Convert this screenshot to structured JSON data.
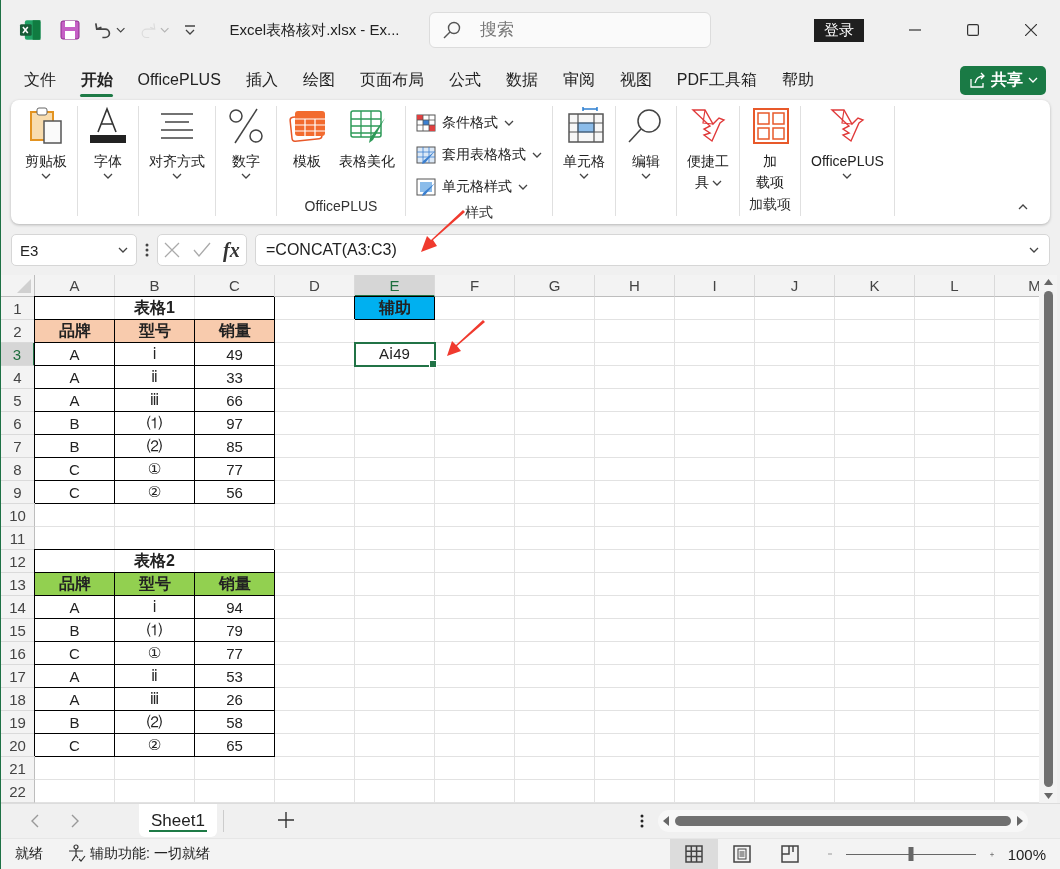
{
  "window": {
    "title": "Excel表格核对.xlsx  -  Ex...",
    "search": {
      "placeholder": "搜索"
    },
    "sign_in": "登录"
  },
  "quick_access": [
    {
      "kind": "save",
      "disabled": false
    },
    {
      "kind": "undo",
      "disabled": false
    },
    {
      "kind": "redo",
      "disabled": true
    },
    {
      "kind": "customize",
      "disabled": false
    }
  ],
  "ribbon_tabs": [
    {
      "label": "文件",
      "selected": false
    },
    {
      "label": "开始",
      "selected": true
    },
    {
      "label": "OfficePLUS",
      "selected": false
    },
    {
      "label": "插入",
      "selected": false
    },
    {
      "label": "绘图",
      "selected": false
    },
    {
      "label": "页面布局",
      "selected": false
    },
    {
      "label": "公式",
      "selected": false
    },
    {
      "label": "数据",
      "selected": false
    },
    {
      "label": "审阅",
      "selected": false
    },
    {
      "label": "视图",
      "selected": false
    },
    {
      "label": "PDF工具箱",
      "selected": false
    },
    {
      "label": "帮助",
      "selected": false
    }
  ],
  "share_button": "共享",
  "ribbon": {
    "groups": [
      {
        "items": [
          {
            "kind": "large",
            "label_lines": [
              "剪贴板"
            ],
            "dropdown": true
          }
        ]
      },
      {
        "items": [
          {
            "kind": "large",
            "label_lines": [
              "字体"
            ],
            "dropdown": true
          }
        ]
      },
      {
        "items": [
          {
            "kind": "large",
            "label_lines": [
              "对齐方式"
            ],
            "dropdown": true
          }
        ]
      },
      {
        "items": [
          {
            "kind": "large",
            "label_lines": [
              "数字"
            ],
            "dropdown": true
          }
        ]
      },
      {
        "label": "OfficePLUS",
        "items": [
          {
            "kind": "large",
            "label_lines": [
              "模板"
            ],
            "dropdown": false
          },
          {
            "kind": "large",
            "label_lines": [
              "表格美化"
            ],
            "dropdown": false
          }
        ]
      },
      {
        "label": "样式",
        "items": [
          {
            "kind": "small",
            "label_lines": [
              "条件格式"
            ],
            "dropdown": true
          },
          {
            "kind": "small",
            "label_lines": [
              "套用表格格式"
            ],
            "dropdown": true
          },
          {
            "kind": "small",
            "label_lines": [
              "单元格样式"
            ],
            "dropdown": true
          }
        ]
      },
      {
        "items": [
          {
            "kind": "large",
            "label_lines": [
              "单元格"
            ],
            "dropdown": true
          }
        ]
      },
      {
        "items": [
          {
            "kind": "large",
            "label_lines": [
              "编辑"
            ],
            "dropdown": true
          }
        ]
      },
      {
        "items": [
          {
            "kind": "large",
            "label_lines": [
              "便捷工",
              "具"
            ],
            "dropdown": true
          }
        ]
      },
      {
        "label": "加载项",
        "items": [
          {
            "kind": "large",
            "label_lines": [
              "加",
              "载项"
            ],
            "dropdown": false
          }
        ]
      },
      {
        "items": [
          {
            "kind": "large",
            "label_lines": [
              "OfficePLUS"
            ],
            "dropdown": true
          }
        ]
      }
    ]
  },
  "formula_bar": {
    "name_box": "E3",
    "function_label": "fx",
    "formula": "=CONCAT(A3:C3)"
  },
  "sheet": {
    "columns": [
      {
        "label": "A",
        "selected": false
      },
      {
        "label": "B",
        "selected": false
      },
      {
        "label": "C",
        "selected": false
      },
      {
        "label": "D",
        "selected": false
      },
      {
        "label": "E",
        "selected": true
      },
      {
        "label": "F",
        "selected": false
      },
      {
        "label": "G",
        "selected": false
      },
      {
        "label": "H",
        "selected": false
      },
      {
        "label": "I",
        "selected": false
      },
      {
        "label": "J",
        "selected": false
      },
      {
        "label": "K",
        "selected": false
      },
      {
        "label": "L",
        "selected": false
      },
      {
        "label": "M",
        "selected": false
      }
    ],
    "rows": [
      {
        "label": "1",
        "selected": false,
        "cells": [
          {
            "kind": "title",
            "text": "表格1"
          },
          "",
          "",
          "",
          {
            "kind": "header",
            "text": "辅助",
            "color": "#00b0f0"
          }
        ]
      },
      {
        "label": "2",
        "selected": false,
        "cells": [
          {
            "kind": "header",
            "text": "品牌",
            "color": "#f8cbad"
          },
          {
            "kind": "header",
            "text": "型号",
            "color": "#f8cbad"
          },
          {
            "kind": "header",
            "text": "销量",
            "color": "#f8cbad"
          }
        ]
      },
      {
        "label": "3",
        "selected": true,
        "cells": [
          {
            "kind": "body",
            "text": "A"
          },
          {
            "kind": "body",
            "text": "ⅰ"
          },
          {
            "kind": "body",
            "text": "49"
          },
          "",
          {
            "kind": "plain",
            "text": "Aⅰ49"
          }
        ]
      },
      {
        "label": "4",
        "selected": false,
        "cells": [
          {
            "kind": "body",
            "text": "A"
          },
          {
            "kind": "body",
            "text": "ⅱ"
          },
          {
            "kind": "body",
            "text": "33"
          }
        ]
      },
      {
        "label": "5",
        "selected": false,
        "cells": [
          {
            "kind": "body",
            "text": "A"
          },
          {
            "kind": "body",
            "text": "ⅲ"
          },
          {
            "kind": "body",
            "text": "66"
          }
        ]
      },
      {
        "label": "6",
        "selected": false,
        "cells": [
          {
            "kind": "body",
            "text": "B"
          },
          {
            "kind": "body",
            "text": "⑴"
          },
          {
            "kind": "body",
            "text": "97"
          }
        ]
      },
      {
        "label": "7",
        "selected": false,
        "cells": [
          {
            "kind": "body",
            "text": "B"
          },
          {
            "kind": "body",
            "text": "⑵"
          },
          {
            "kind": "body",
            "text": "85"
          }
        ]
      },
      {
        "label": "8",
        "selected": false,
        "cells": [
          {
            "kind": "body",
            "text": "C"
          },
          {
            "kind": "body",
            "text": "①"
          },
          {
            "kind": "body",
            "text": "77"
          }
        ]
      },
      {
        "label": "9",
        "selected": false,
        "cells": [
          {
            "kind": "body",
            "text": "C"
          },
          {
            "kind": "body",
            "text": "②"
          },
          {
            "kind": "body",
            "text": "56"
          }
        ]
      },
      {
        "label": "10",
        "selected": false,
        "cells": []
      },
      {
        "label": "11",
        "selected": false,
        "cells": []
      },
      {
        "label": "12",
        "selected": false,
        "cells": [
          {
            "kind": "title",
            "text": "表格2"
          },
          "",
          ""
        ]
      },
      {
        "label": "13",
        "selected": false,
        "cells": [
          {
            "kind": "header",
            "text": "品牌",
            "color": "#92d050"
          },
          {
            "kind": "header",
            "text": "型号",
            "color": "#92d050"
          },
          {
            "kind": "header",
            "text": "销量",
            "color": "#92d050"
          }
        ]
      },
      {
        "label": "14",
        "selected": false,
        "cells": [
          {
            "kind": "body",
            "text": "A"
          },
          {
            "kind": "body",
            "text": "ⅰ"
          },
          {
            "kind": "body",
            "text": "94"
          }
        ]
      },
      {
        "label": "15",
        "selected": false,
        "cells": [
          {
            "kind": "body",
            "text": "B"
          },
          {
            "kind": "body",
            "text": "⑴"
          },
          {
            "kind": "body",
            "text": "79"
          }
        ]
      },
      {
        "label": "16",
        "selected": false,
        "cells": [
          {
            "kind": "body",
            "text": "C"
          },
          {
            "kind": "body",
            "text": "①"
          },
          {
            "kind": "body",
            "text": "77"
          }
        ]
      },
      {
        "label": "17",
        "selected": false,
        "cells": [
          {
            "kind": "body",
            "text": "A"
          },
          {
            "kind": "body",
            "text": "ⅱ"
          },
          {
            "kind": "body",
            "text": "53"
          }
        ]
      },
      {
        "label": "18",
        "selected": false,
        "cells": [
          {
            "kind": "body",
            "text": "A"
          },
          {
            "kind": "body",
            "text": "ⅲ"
          },
          {
            "kind": "body",
            "text": "26"
          }
        ]
      },
      {
        "label": "19",
        "selected": false,
        "cells": [
          {
            "kind": "body",
            "text": "B"
          },
          {
            "kind": "body",
            "text": "⑵"
          },
          {
            "kind": "body",
            "text": "58"
          }
        ]
      },
      {
        "label": "20",
        "selected": false,
        "cells": [
          {
            "kind": "body",
            "text": "C"
          },
          {
            "kind": "body",
            "text": "②"
          },
          {
            "kind": "body",
            "text": "65"
          }
        ]
      },
      {
        "label": "21",
        "selected": false,
        "cells": []
      },
      {
        "label": "22",
        "selected": false,
        "cells": []
      }
    ]
  },
  "sheet_tabs": [
    {
      "label": "Sheet1",
      "selected": true
    }
  ],
  "status_bar": {
    "ready": "就绪",
    "accessibility": "辅助功能: 一切就绪",
    "views": [
      {
        "kind": "normal",
        "selected": true
      },
      {
        "kind": "page-layout",
        "selected": false
      },
      {
        "kind": "page-break",
        "selected": false
      }
    ],
    "zoom": {
      "level": 0.5,
      "reading": "100%"
    }
  }
}
